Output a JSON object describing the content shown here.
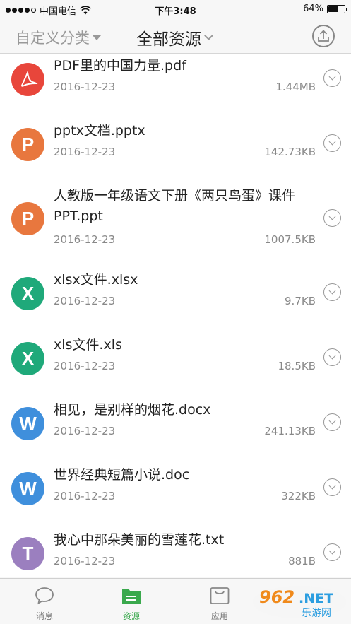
{
  "status_bar": {
    "carrier": "中国电信",
    "time": "下午3:48",
    "battery": "64%",
    "battery_level": 0.64
  },
  "nav": {
    "left_label": "自定义分类",
    "title": "全部资源",
    "upload_icon": "upload-icon"
  },
  "files": [
    {
      "type": "pdf",
      "icon_letter": "",
      "color": "#e8463b",
      "name": "PDF里的中国力量.pdf",
      "date": "2016-12-23",
      "size": "1.44MB"
    },
    {
      "type": "ppt",
      "icon_letter": "P",
      "color": "#e8773e",
      "name": "pptx文档.pptx",
      "date": "2016-12-23",
      "size": "142.73KB"
    },
    {
      "type": "ppt",
      "icon_letter": "P",
      "color": "#e8773e",
      "name": "人教版一年级语文下册《两只鸟蛋》课件PPT.ppt",
      "date": "2016-12-23",
      "size": "1007.5KB"
    },
    {
      "type": "xls",
      "icon_letter": "X",
      "color": "#1fa97a",
      "name": "xlsx文件.xlsx",
      "date": "2016-12-23",
      "size": "9.7KB"
    },
    {
      "type": "xls",
      "icon_letter": "X",
      "color": "#1fa97a",
      "name": "xls文件.xls",
      "date": "2016-12-23",
      "size": "18.5KB"
    },
    {
      "type": "doc",
      "icon_letter": "W",
      "color": "#3f8fdc",
      "name": "相见，是别样的烟花.docx",
      "date": "2016-12-23",
      "size": "241.13KB"
    },
    {
      "type": "doc",
      "icon_letter": "W",
      "color": "#3f8fdc",
      "name": "世界经典短篇小说.doc",
      "date": "2016-12-23",
      "size": "322KB"
    },
    {
      "type": "txt",
      "icon_letter": "T",
      "color": "#9b7fbf",
      "name": "我心中那朵美丽的雪莲花.txt",
      "date": "2016-12-23",
      "size": "881B"
    }
  ],
  "tabs": [
    {
      "label": "消息",
      "icon": "message-icon",
      "active": false
    },
    {
      "label": "资源",
      "icon": "folder-icon",
      "active": true
    },
    {
      "label": "应用",
      "icon": "app-icon",
      "active": false
    }
  ],
  "watermark": {
    "text": "962.NET",
    "subtext": "乐游网"
  },
  "colors": {
    "accent": "#3aa94d",
    "text_primary": "#222222",
    "text_secondary": "#888888"
  }
}
